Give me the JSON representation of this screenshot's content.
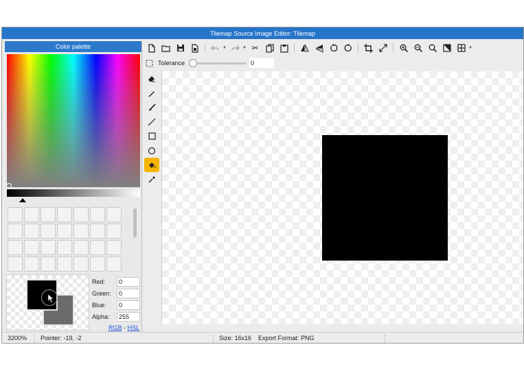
{
  "window": {
    "title": "Tilemap Source Image Editor: Tilemap"
  },
  "palette": {
    "header": "Color palette",
    "primary_color": "#000000",
    "secondary_color": "#6b6b6b",
    "channels": [
      {
        "label": "Red:",
        "value": "0"
      },
      {
        "label": "Green:",
        "value": "0"
      },
      {
        "label": "Blue:",
        "value": "0"
      },
      {
        "label": "Alpha:",
        "value": "255"
      }
    ],
    "mode_rgb": "RGB",
    "mode_sep": "-",
    "mode_hsl": "HSL"
  },
  "toolbar": {
    "items": [
      "new-file-icon",
      "open-folder-icon",
      "save-icon",
      "save-as-icon",
      "undo-icon",
      "redo-icon",
      "cut-icon",
      "copy-icon",
      "paste-icon",
      "flip-horizontal-icon",
      "flip-vertical-icon",
      "rotate-left-icon",
      "rotate-right-icon",
      "crop-icon",
      "resize-icon",
      "zoom-in-icon",
      "zoom-out-icon",
      "zoom-reset-icon",
      "background-toggle-icon",
      "grid-icon"
    ]
  },
  "options": {
    "tolerance_label": "Tolerance",
    "tolerance_value": "0",
    "tolerance_level": 0
  },
  "tools": {
    "items": [
      "marquee-select-icon",
      "eraser-icon",
      "pencil-icon",
      "brush-icon",
      "line-icon",
      "rectangle-icon",
      "ellipse-icon",
      "fill-bucket-icon",
      "eyedropper-icon"
    ],
    "active": "fill-bucket-icon"
  },
  "canvas": {
    "tile_color": "#000000"
  },
  "status": {
    "zoom": "3200%",
    "pointer": "Pointer: -19, -2",
    "size": "Size: 16x16",
    "export_format": "Export Format: PNG"
  },
  "colors": {
    "accent": "#2675c9",
    "active_tool": "#f5b400"
  }
}
